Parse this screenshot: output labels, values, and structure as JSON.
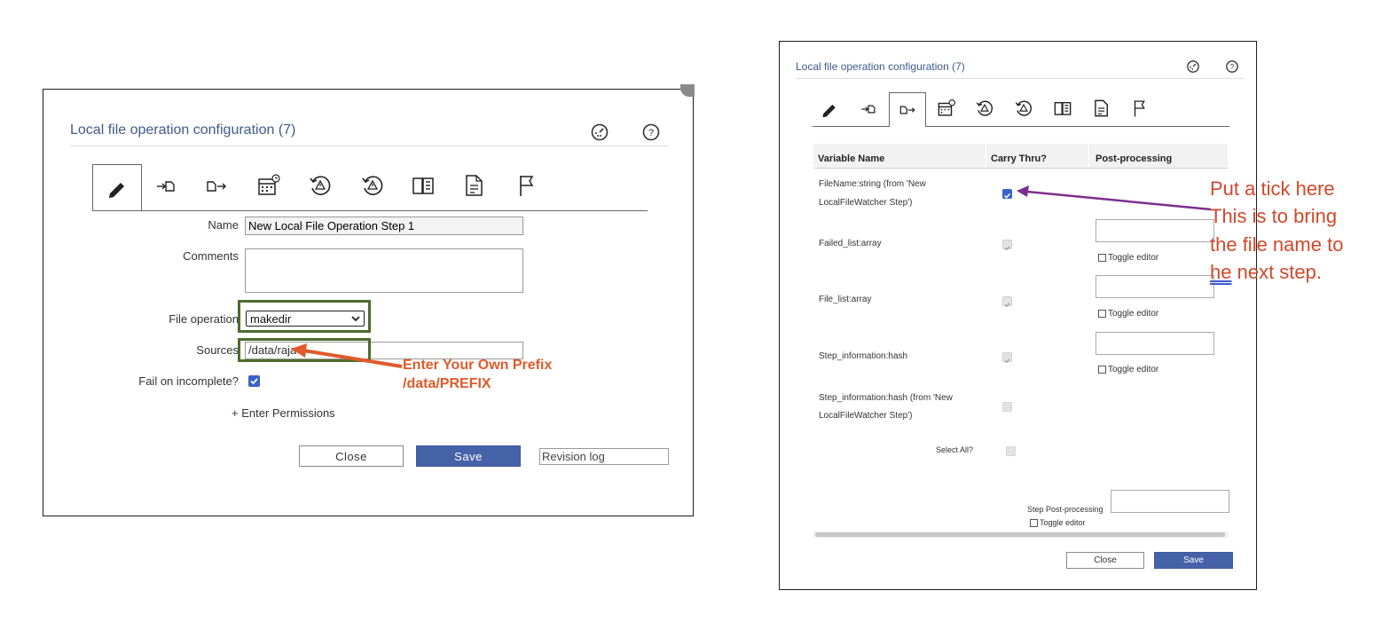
{
  "left_dialog": {
    "title": "Local file operation configuration (7)",
    "fields": {
      "name_label": "Name",
      "name_value": "New Local File Operation Step 1",
      "comments_label": "Comments",
      "comments_value": "",
      "file_operation_label": "File operation",
      "file_operation_value": "makedir",
      "sources_label": "Sources",
      "sources_value": "/data/raja",
      "fail_label": "Fail on incomplete?",
      "fail_checked": true,
      "permissions_label": "+ Enter Permissions"
    },
    "buttons": {
      "close": "Close",
      "save": "Save"
    },
    "revision_log": "Revision log"
  },
  "left_annotation": {
    "line1": "Enter Your Own Prefix",
    "line2": "/data/PREFIX",
    "color": "#e05a2b",
    "box_color": "#4e6b2e"
  },
  "right_dialog": {
    "title": "Local file operation configuration (7)",
    "columns": [
      "Variable Name",
      "Carry Thru?",
      "Post-processing"
    ],
    "rows": [
      {
        "name_line1": "FileName:string (from 'New",
        "name_line2": "LocalFileWatcher Step')",
        "checked": true,
        "post": false
      },
      {
        "name_line1": "Failed_list:array",
        "name_line2": "",
        "checked": true,
        "post": true,
        "toggle": "Toggle editor"
      },
      {
        "name_line1": "File_list:array",
        "name_line2": "",
        "checked": true,
        "post": true,
        "toggle": "Toggle editor"
      },
      {
        "name_line1": "Step_information:hash",
        "name_line2": "",
        "checked": true,
        "post": true,
        "toggle": "Toggle editor"
      },
      {
        "name_line1": "Step_information:hash (from 'New",
        "name_line2": "LocalFileWatcher Step')",
        "checked": false,
        "post": false
      }
    ],
    "select_all": "Select All?",
    "step_post_processing": "Step Post-processing",
    "step_toggle": "Toggle editor",
    "buttons": {
      "close": "Close",
      "save": "Save"
    }
  },
  "right_annotation": {
    "line1": "Put a tick here",
    "line2": "This is to bring",
    "line3": "the file name to",
    "line4_link": "he",
    "line4_rest": " next step.",
    "color": "#d2482a",
    "arrow_color": "#7b2f8f"
  },
  "icons": [
    "pencil-icon",
    "input-icon",
    "output-icon",
    "schedule-icon",
    "history-icon",
    "alert-history-icon",
    "book-icon",
    "document-icon",
    "flag-icon",
    "speedometer-icon",
    "help-icon"
  ]
}
